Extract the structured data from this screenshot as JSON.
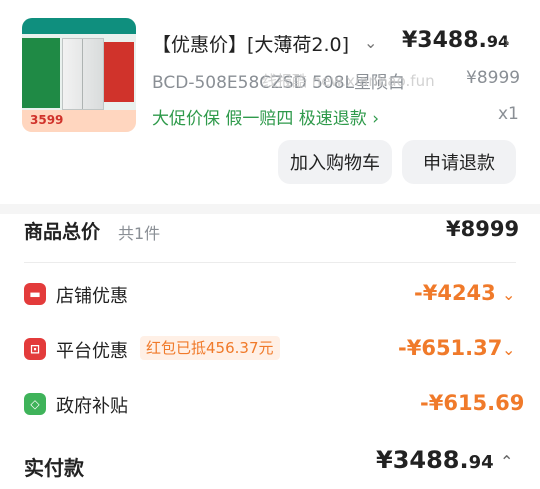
{
  "product": {
    "thumb_price": "3599",
    "title": "【优惠价】[大薄荷2.0]",
    "price_int": "¥3488.",
    "price_dec": "94",
    "spec": "BCD-508E58CZSD 508L星陨白",
    "original_price": "¥8999",
    "watermark": "线报酷 new.xianbao.fun",
    "tags": "大促价保  假一赔四  极速退款",
    "qty": "x1"
  },
  "actions": {
    "add_cart": "加入购物车",
    "refund": "申请退款"
  },
  "summary": {
    "total_label": "商品总价",
    "total_count": "共1件",
    "total_value": "¥8999",
    "shop_discount_label": "店铺优惠",
    "shop_discount_value": "-¥4243",
    "platform_discount_label": "平台优惠",
    "platform_badge": "红包已抵456.37元",
    "platform_discount_value": "-¥651.37",
    "gov_subsidy_label": "政府补贴",
    "gov_subsidy_value": "-¥615.69",
    "paid_label": "实付款",
    "paid_int": "¥3488.",
    "paid_dec": "94"
  },
  "colors": {
    "discount": "#f07a2a",
    "tag_green": "#2f9a4b",
    "icon_red": "#e33b3b",
    "icon_green": "#3fb35a"
  },
  "icons": [
    "chevron-down-icon",
    "chevron-right-icon",
    "shop-icon",
    "platform-icon",
    "gov-icon",
    "chevron-up-icon"
  ]
}
